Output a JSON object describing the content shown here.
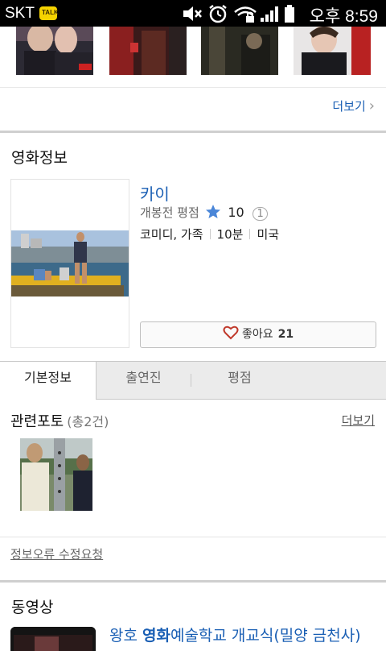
{
  "status_bar": {
    "carrier": "SKT",
    "talk_badge": "TALK",
    "time": "오후 8:59"
  },
  "photo_strip": {
    "more_label": "더보기"
  },
  "movie_info": {
    "section_title": "영화정보",
    "title": "카이",
    "rating_label": "개봉전 평점",
    "rating_score": "10",
    "rating_count": "1",
    "genre": "코미디, 가족",
    "runtime": "10분",
    "country": "미국",
    "like_label": "좋아요",
    "like_count": "21"
  },
  "tabs": [
    {
      "label": "기본정보",
      "active": true
    },
    {
      "label": "출연진",
      "active": false
    },
    {
      "label": "평점",
      "active": false
    }
  ],
  "related_photos": {
    "title": "관련포토",
    "count_label": "(총2건)",
    "more_label": "더보기"
  },
  "report_link": "정보오류 수정요청",
  "videos": {
    "section_title": "동영상",
    "first_item_prefix": "왕호 ",
    "first_item_highlight": "영화",
    "first_item_suffix": "예술학교 개교식(밀양 금천사)"
  },
  "colors": {
    "link_blue": "#1a5fb4",
    "star_blue": "#4a86d8",
    "heart_red": "#c0392b"
  }
}
